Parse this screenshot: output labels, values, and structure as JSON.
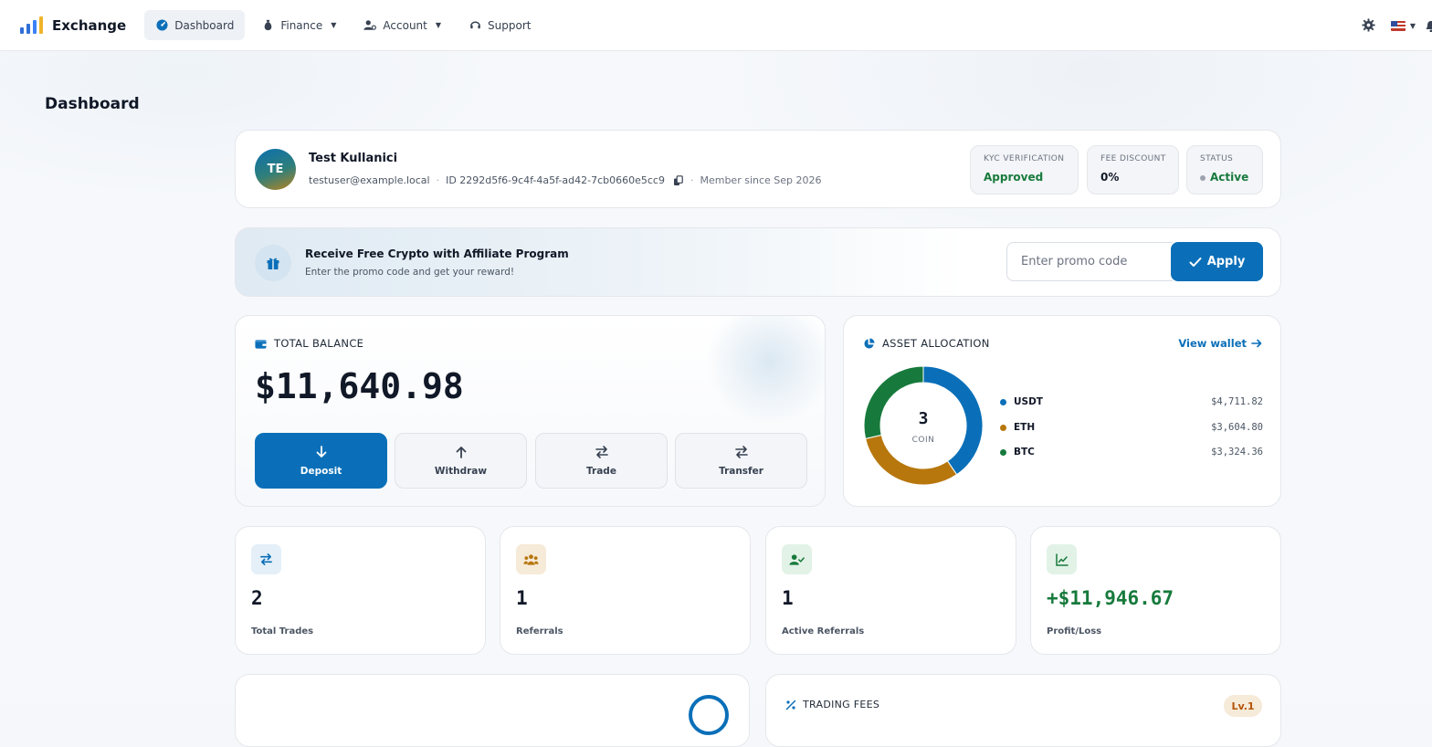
{
  "brand": {
    "name": "Exchange"
  },
  "nav": {
    "items": [
      {
        "label": "Dashboard"
      },
      {
        "label": "Finance"
      },
      {
        "label": "Account"
      },
      {
        "label": "Support"
      }
    ]
  },
  "page": {
    "title": "Dashboard"
  },
  "profile": {
    "initials": "TE",
    "name": "Test Kullanici",
    "email": "testuser@example.local",
    "id": "ID 2292d5f6-9c4f-4a5f-ad42-7cb0660e5cc9",
    "member_since": "Member since Sep 2026",
    "kyc_label": "KYC VERIFICATION",
    "kyc_value": "Approved",
    "fee_label": "FEE DISCOUNT",
    "fee_value": "0%",
    "status_label": "STATUS",
    "status_value": "Active"
  },
  "promo": {
    "title": "Receive Free Crypto with Affiliate Program",
    "subtitle": "Enter the promo code and get your reward!",
    "placeholder": "Enter promo code",
    "apply_label": "Apply"
  },
  "balance": {
    "label": "TOTAL BALANCE",
    "amount": "$11,640.98",
    "actions": [
      {
        "label": "Deposit"
      },
      {
        "label": "Withdraw"
      },
      {
        "label": "Trade"
      },
      {
        "label": "Transfer"
      }
    ]
  },
  "allocation": {
    "label": "ASSET ALLOCATION",
    "view_wallet": "View wallet",
    "center_value": "3",
    "center_label": "COIN",
    "assets": [
      {
        "name": "USDT",
        "value": "$4,711.82",
        "amount": 4711.82,
        "color": "#0a6fb8"
      },
      {
        "name": "ETH",
        "value": "$3,604.80",
        "amount": 3604.8,
        "color": "#b7770d"
      },
      {
        "name": "BTC",
        "value": "$3,324.36",
        "amount": 3324.36,
        "color": "#177a3c"
      }
    ]
  },
  "stats": [
    {
      "value": "2",
      "label": "Total Trades"
    },
    {
      "value": "1",
      "label": "Referrals"
    },
    {
      "value": "1",
      "label": "Active Referrals"
    },
    {
      "value": "+$11,946.67",
      "label": "Profit/Loss"
    }
  ],
  "bottom": {
    "fees_label": "TRADING FEES",
    "fees_badge": "Lv.1"
  },
  "colors": {
    "accent": "#0a6fb8",
    "success": "#177a3c",
    "warning": "#b7770d"
  }
}
